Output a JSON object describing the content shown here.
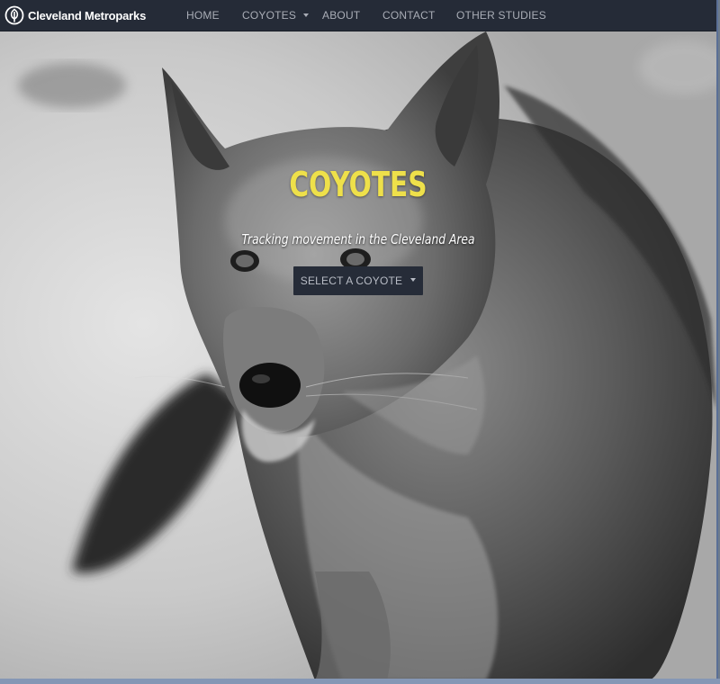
{
  "brand": {
    "name": "Cleveland Metroparks",
    "logo_icon": "leaf-circle-logo"
  },
  "nav": {
    "items": [
      {
        "label": "HOME"
      },
      {
        "label": "COYOTES",
        "has_dropdown": true
      },
      {
        "label": "ABOUT"
      },
      {
        "label": "CONTACT"
      },
      {
        "label": "OTHER STUDIES"
      }
    ]
  },
  "hero": {
    "title": "COYOTES",
    "subtitle": "Tracking movement in the Cleveland Area",
    "select_button": "SELECT A COYOTE",
    "background_image": "black-and-white coyote photo"
  },
  "colors": {
    "navbar_bg": "#252b37",
    "nav_text": "#a9adb6",
    "title_accent": "#eee04a",
    "button_bg": "#262c38"
  }
}
